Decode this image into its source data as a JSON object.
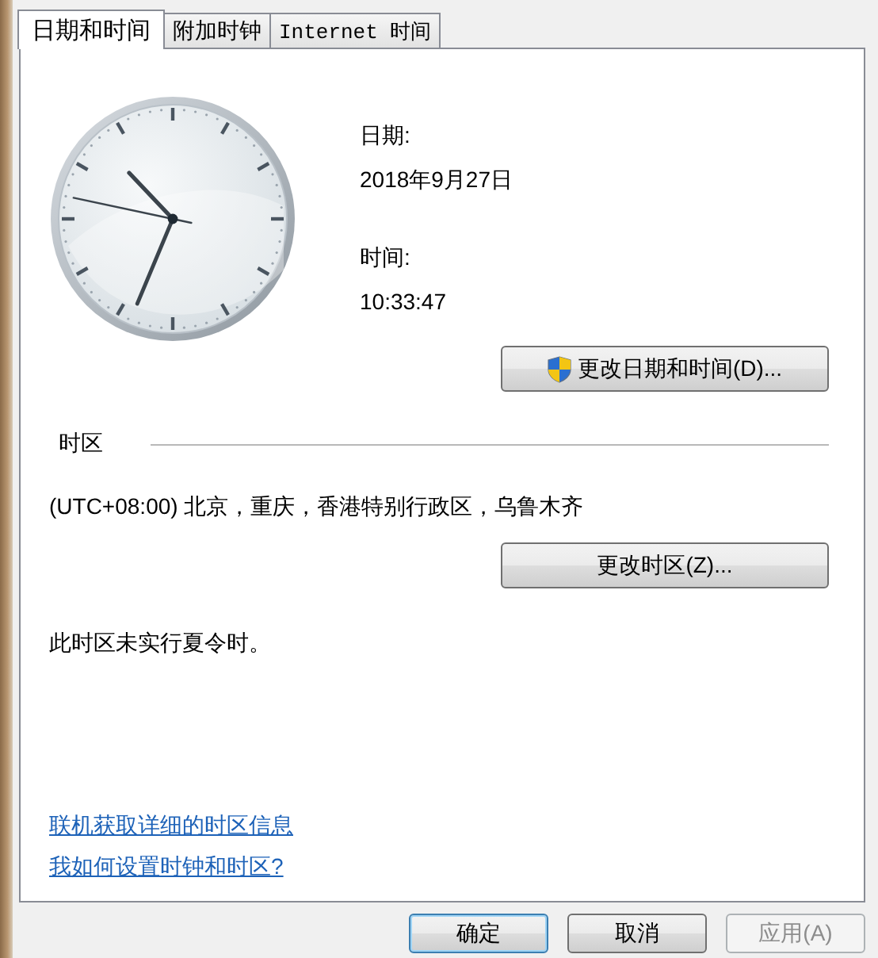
{
  "tabs": [
    {
      "label": "日期和时间",
      "selected": true
    },
    {
      "label": "附加时钟",
      "selected": false
    },
    {
      "label": "Internet 时间",
      "selected": false
    }
  ],
  "date": {
    "label": "日期:",
    "value": "2018年9月27日"
  },
  "time": {
    "label": "时间:",
    "value": "10:33:47"
  },
  "change_date_button": "更改日期和时间(D)...",
  "time_zone": {
    "heading": "时区",
    "value": "(UTC+08:00) 北京，重庆，香港特别行政区，乌鲁木齐",
    "button": "更改时区(Z)..."
  },
  "dst_note": "此时区未实行夏令时。",
  "links": [
    "联机获取详细的时区信息",
    "我如何设置时钟和时区?"
  ],
  "buttons": [
    {
      "label": "确定",
      "default": true,
      "disabled": false
    },
    {
      "label": "取消",
      "default": false,
      "disabled": false
    },
    {
      "label": "应用(A)",
      "default": false,
      "disabled": true
    }
  ]
}
